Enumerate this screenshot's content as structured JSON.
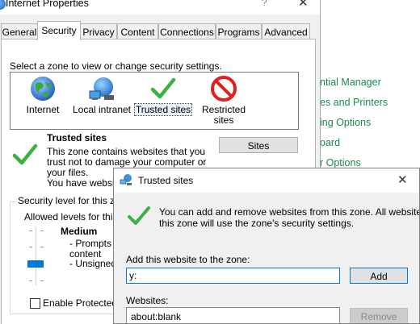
{
  "control_panel": {
    "links": [
      "ntial Manager",
      "es and Printers",
      "ing Options",
      "oard",
      "r Options"
    ],
    "link_color": "#1a8a50"
  },
  "internet_properties": {
    "title": "Internet Properties",
    "help_glyph": "?",
    "close_glyph": "✕",
    "tabs": [
      "General",
      "Security",
      "Privacy",
      "Content",
      "Connections",
      "Programs",
      "Advanced"
    ],
    "active_tab": "Security",
    "zone_prompt": "Select a zone to view or change security settings.",
    "zones": [
      {
        "label": "Internet",
        "icon": "globe-icon"
      },
      {
        "label": "Local intranet",
        "icon": "network-globe-icon"
      },
      {
        "label": "Trusted sites",
        "icon": "checkmark-icon"
      },
      {
        "label": "Restricted sites",
        "icon": "no-entry-icon"
      }
    ],
    "selected_zone": "Trusted sites",
    "zone_name": "Trusted sites",
    "zone_description": [
      "This zone contains websites that you",
      "trust not to damage your computer or",
      "your files.",
      "You have websit"
    ],
    "sites_button": "Sites",
    "security_level_legend": "Security level for this zo",
    "allowed_levels_label": "Allowed levels for this z",
    "level_name": "Medium",
    "level_description": [
      "- Prompts b",
      "content",
      "- Unsigned"
    ],
    "protected_mode_label": "Enable Protected M",
    "protected_mode_checked": false
  },
  "trusted_sites": {
    "title": "Trusted sites",
    "close_glyph": "✕",
    "info_lines": [
      "You can add and remove websites from this zone. All websites in",
      "this zone will use the zone's security settings."
    ],
    "add_label": "Add this website to the zone:",
    "add_value": "y:",
    "add_button": "Add",
    "websites_label": "Websites:",
    "websites": [
      "about:blank"
    ],
    "remove_button": "Remove"
  },
  "colors": {
    "accent": "#0078d7",
    "check_green": "#3cb043",
    "dialog_bg": "#f0f0f0"
  }
}
